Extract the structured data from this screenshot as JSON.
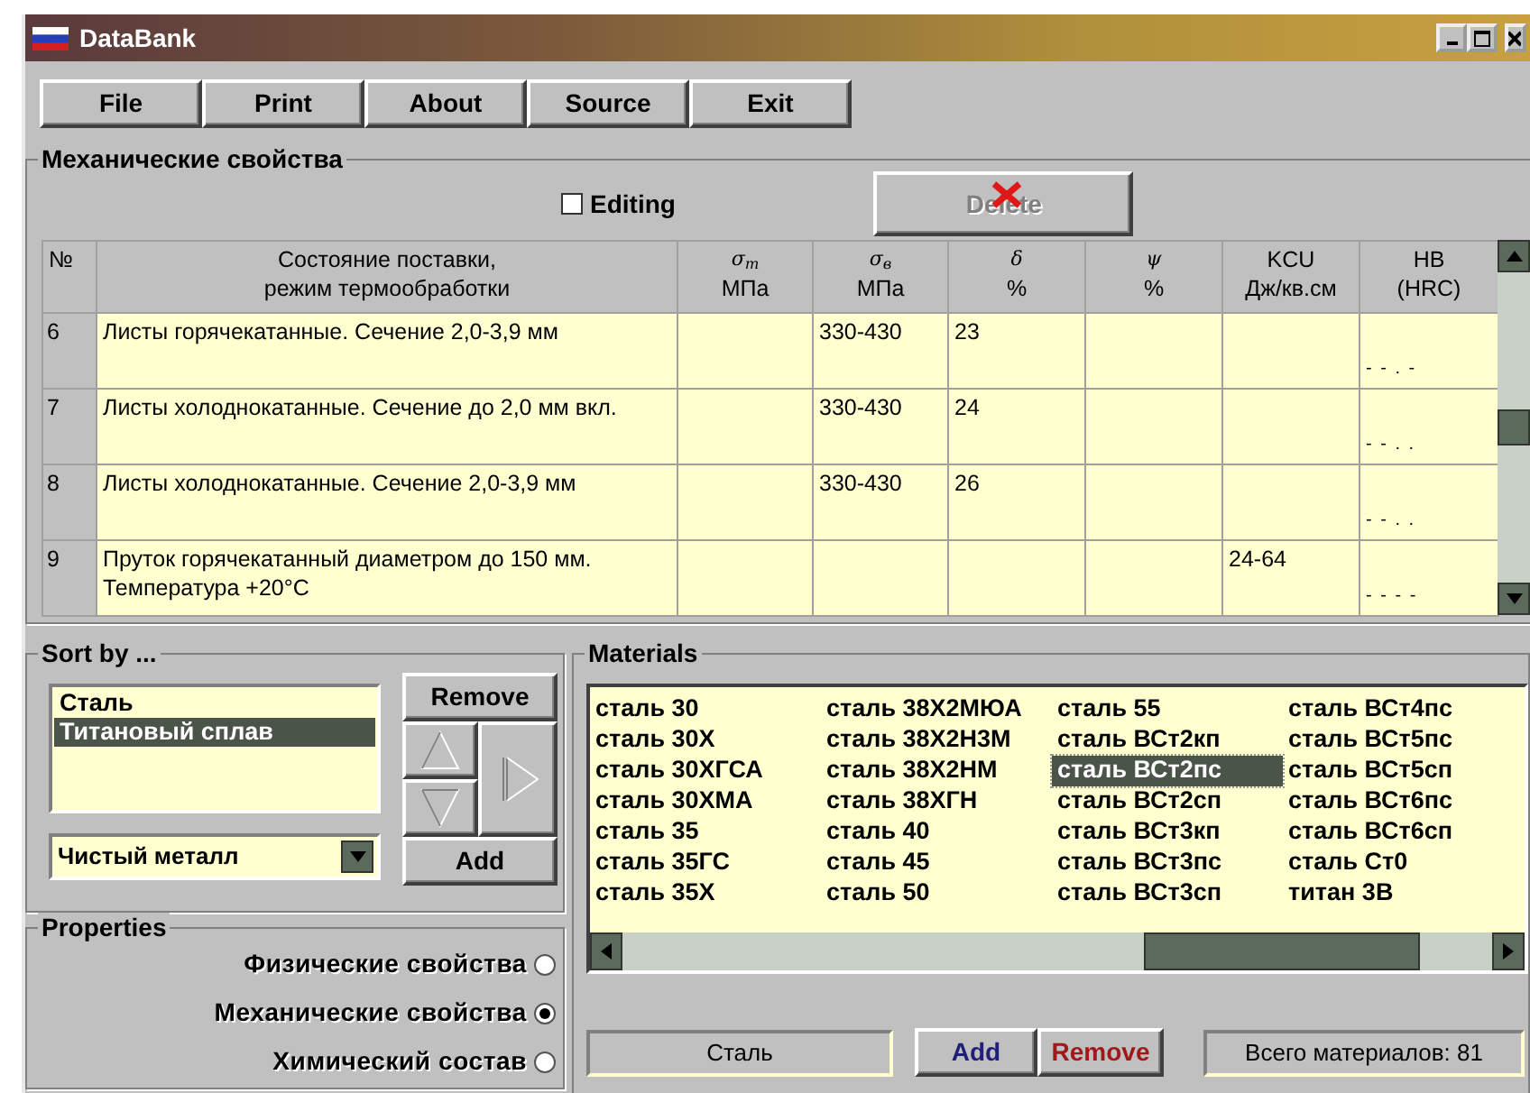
{
  "window": {
    "title": "DataBank"
  },
  "menu": [
    "File",
    "Print",
    "About",
    "Source",
    "Exit"
  ],
  "mechanical": {
    "title": "Механические свойства",
    "editing": {
      "label": "Editing",
      "checked": false
    },
    "delete_button": {
      "label": "Delete",
      "disabled": true
    },
    "table": {
      "columns": [
        {
          "lines": [
            "№"
          ]
        },
        {
          "lines": [
            "Состояние поставки,",
            "режим термообработки"
          ]
        },
        {
          "lines": [
            "σ$_{т}$",
            "МПа"
          ]
        },
        {
          "lines": [
            "σ$_{в}$",
            "МПа"
          ]
        },
        {
          "lines": [
            "δ",
            "%"
          ]
        },
        {
          "lines": [
            "ψ",
            "%"
          ]
        },
        {
          "lines": [
            "KCU",
            "Дж/кв.см"
          ]
        },
        {
          "lines": [
            "HB",
            "(HRC)"
          ]
        }
      ],
      "rows": [
        {
          "cells": [
            "6",
            "Листы горячекатанные. Сечение 2,0-3,9 мм",
            "",
            "330-430",
            "23",
            "",
            "",
            "- - . -"
          ]
        },
        {
          "cells": [
            "7",
            "Листы холоднокатанные. Сечение до 2,0 мм вкл.",
            "",
            "330-430",
            "24",
            "",
            "",
            "- - . ."
          ]
        },
        {
          "cells": [
            "8",
            "Листы холоднокатанные. Сечение 2,0-3,9 мм",
            "",
            "330-430",
            "26",
            "",
            "",
            "- - . ."
          ]
        },
        {
          "cells": [
            "9",
            "Пруток горячекатанный диаметром до 150 мм. Температура +20°C",
            "",
            "",
            "",
            "",
            "24-64",
            "- - - -"
          ]
        }
      ]
    }
  },
  "sort": {
    "title": "Sort by ...",
    "items": [
      {
        "label": "Сталь",
        "selected": false
      },
      {
        "label": "Титановый сплав",
        "selected": true
      }
    ],
    "combo": {
      "value": "Чистый металл"
    },
    "remove_button": "Remove",
    "add_button": "Add"
  },
  "properties": {
    "title": "Properties",
    "options": [
      {
        "label": "Физические свойства",
        "selected": false
      },
      {
        "label": "Механические свойства",
        "selected": true
      },
      {
        "label": "Химический состав",
        "selected": false
      }
    ]
  },
  "materials": {
    "title": "Materials",
    "items": [
      {
        "label": "сталь 30",
        "selected": false
      },
      {
        "label": "сталь 30Х",
        "selected": false
      },
      {
        "label": "сталь 30ХГСА",
        "selected": false
      },
      {
        "label": "сталь 30ХМА",
        "selected": false
      },
      {
        "label": "сталь 35",
        "selected": false
      },
      {
        "label": "сталь 35ГС",
        "selected": false
      },
      {
        "label": "сталь 35Х",
        "selected": false
      },
      {
        "label": "сталь 38Х2МЮА",
        "selected": false
      },
      {
        "label": "сталь 38Х2Н3М",
        "selected": false
      },
      {
        "label": "сталь 38Х2НМ",
        "selected": false
      },
      {
        "label": "сталь 38ХГН",
        "selected": false
      },
      {
        "label": "сталь 40",
        "selected": false
      },
      {
        "label": "сталь 45",
        "selected": false
      },
      {
        "label": "сталь 50",
        "selected": false
      },
      {
        "label": "сталь 55",
        "selected": false
      },
      {
        "label": "сталь ВСт2кп",
        "selected": false
      },
      {
        "label": "сталь ВСт2пс",
        "selected": true
      },
      {
        "label": "сталь ВСт2сп",
        "selected": false
      },
      {
        "label": "сталь ВСт3кп",
        "selected": false
      },
      {
        "label": "сталь ВСт3пс",
        "selected": false
      },
      {
        "label": "сталь ВСт3сп",
        "selected": false
      },
      {
        "label": "сталь ВСт4пс",
        "selected": false
      },
      {
        "label": "сталь ВСт5пс",
        "selected": false
      },
      {
        "label": "сталь ВСт5сп",
        "selected": false
      },
      {
        "label": "сталь ВСт6пс",
        "selected": false
      },
      {
        "label": "сталь ВСт6сп",
        "selected": false
      },
      {
        "label": "сталь Ст0",
        "selected": false
      },
      {
        "label": "титан 3В",
        "selected": false
      }
    ],
    "current": "Сталь",
    "add_button": "Add",
    "remove_button": "Remove",
    "total": "Всего материалов: 81"
  }
}
